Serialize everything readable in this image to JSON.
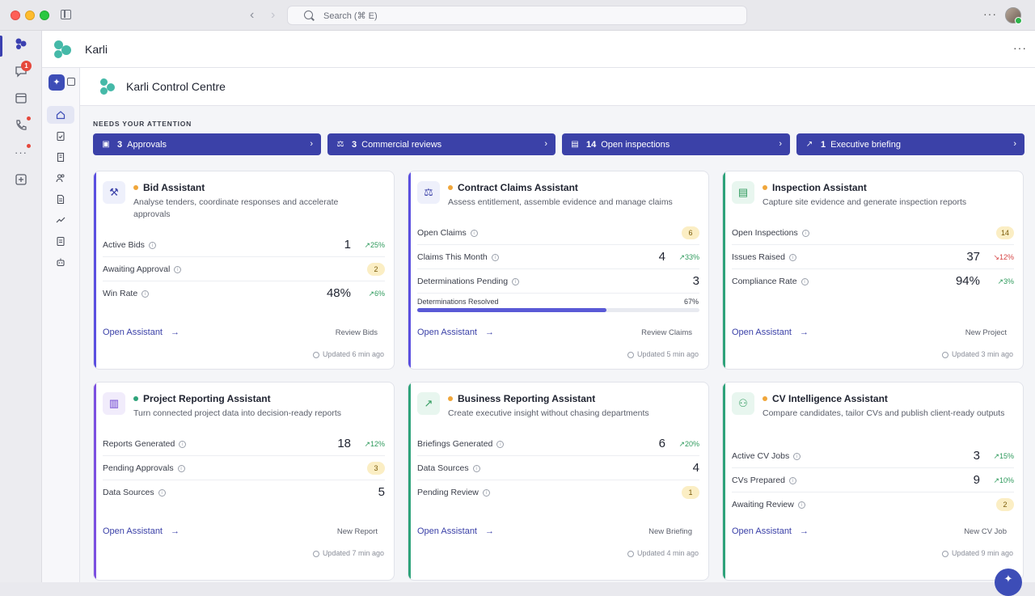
{
  "search": {
    "placeholder": "Search (⌘ E)"
  },
  "rail": {
    "chat_badge": "1"
  },
  "app": {
    "name": "Karli"
  },
  "page": {
    "title": "Karli Control Centre",
    "attention_label": "NEEDS YOUR ATTENTION"
  },
  "attention": [
    {
      "count": "3",
      "label": "Approvals",
      "icon": "clipboard-icon"
    },
    {
      "count": "3",
      "label": "Commercial reviews",
      "icon": "scale-icon"
    },
    {
      "count": "14",
      "label": "Open inspections",
      "icon": "checklist-icon"
    },
    {
      "count": "1",
      "label": "Executive briefing",
      "icon": "trend-icon"
    }
  ],
  "cards": [
    {
      "title": "Bid Assistant",
      "desc": "Analyse tenders, coordinate responses and accelerate approvals",
      "accent": "#5b4fe0",
      "status": "#f0a63a",
      "icon": "gavel-icon",
      "metrics": [
        {
          "label": "Active Bids",
          "value": "1",
          "trend": "25%"
        },
        {
          "label": "Awaiting Approval",
          "pill": "2"
        },
        {
          "label": "Win Rate",
          "value": "48%",
          "trend": "6%"
        }
      ],
      "open": "Open Assistant",
      "action": "Review Bids",
      "updated": "Updated 6 min ago"
    },
    {
      "title": "Contract Claims Assistant",
      "desc": "Assess entitlement, assemble evidence and manage claims",
      "accent": "#5b4fe0",
      "status": "#f0a63a",
      "icon": "scale-icon",
      "metrics": [
        {
          "label": "Open Claims",
          "pill": "6"
        },
        {
          "label": "Claims This Month",
          "value": "4",
          "trend": "33%"
        },
        {
          "label": "Determinations Pending",
          "value": "3"
        }
      ],
      "progress": {
        "label": "Determinations Resolved",
        "value": "67%",
        "fraction": 0.67
      },
      "open": "Open Assistant",
      "action": "Review Claims",
      "updated": "Updated 5 min ago"
    },
    {
      "title": "Inspection Assistant",
      "desc": "Capture site evidence and generate inspection reports",
      "accent": "#2ea37a",
      "status": "#f0a63a",
      "icon": "clipboard-icon",
      "metrics": [
        {
          "label": "Open Inspections",
          "pill": "14"
        },
        {
          "label": "Issues Raised",
          "value": "37",
          "trend": "12%",
          "down": true
        },
        {
          "label": "Compliance Rate",
          "value": "94%",
          "trend": "3%"
        }
      ],
      "open": "Open Assistant",
      "action": "New Project",
      "updated": "Updated 3 min ago"
    },
    {
      "title": "Project Reporting Assistant",
      "desc": "Turn connected project data into decision-ready reports",
      "accent": "#7c4fe0",
      "status": "#2ea37a",
      "icon": "bar-chart-icon",
      "metrics": [
        {
          "label": "Reports Generated",
          "value": "18",
          "trend": "12%"
        },
        {
          "label": "Pending Approvals",
          "pill": "3"
        },
        {
          "label": "Data Sources",
          "value": "5"
        }
      ],
      "open": "Open Assistant",
      "action": "New Report",
      "updated": "Updated 7 min ago"
    },
    {
      "title": "Business Reporting Assistant",
      "desc": "Create executive insight without chasing departments",
      "accent": "#2ea37a",
      "status": "#f0a63a",
      "icon": "trend-icon",
      "metrics": [
        {
          "label": "Briefings Generated",
          "value": "6",
          "trend": "20%"
        },
        {
          "label": "Data Sources",
          "value": "4"
        },
        {
          "label": "Pending Review",
          "pill": "1"
        }
      ],
      "open": "Open Assistant",
      "action": "New Briefing",
      "updated": "Updated 4 min ago"
    },
    {
      "title": "CV Intelligence Assistant",
      "desc": "Compare candidates, tailor CVs and publish client-ready outputs",
      "accent": "#2ea37a",
      "status": "#f0a63a",
      "icon": "people-icon",
      "metrics": [
        {
          "label": "Active CV Jobs",
          "value": "3",
          "trend": "15%"
        },
        {
          "label": "CVs Prepared",
          "value": "9",
          "trend": "10%"
        },
        {
          "label": "Awaiting Review",
          "pill": "2"
        }
      ],
      "open": "Open Assistant",
      "action": "New CV Job",
      "updated": "Updated 9 min ago"
    }
  ]
}
